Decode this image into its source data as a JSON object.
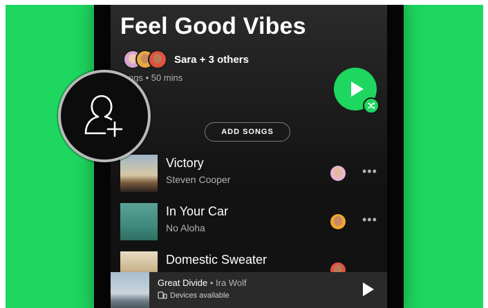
{
  "playlist": {
    "title": "Feel Good Vibes",
    "collaborators_label": "Sara + 3 others",
    "meta": "ngs • 50 mins",
    "add_songs_label": "ADD SONGS"
  },
  "tracks": [
    {
      "title": "Victory",
      "artist": "Steven Cooper"
    },
    {
      "title": "In Your Car",
      "artist": "No Aloha"
    },
    {
      "title": "Domestic Sweater",
      "artist": ""
    }
  ],
  "now_playing": {
    "title": "Great Divide",
    "separator": " • ",
    "artist": "Ira Wolf",
    "devices_label": "Devices available"
  },
  "icons": {
    "add_collaborator": "person-plus-icon",
    "play": "play-icon",
    "shuffle": "shuffle-icon",
    "more": "more-options-icon",
    "devices": "devices-icon"
  },
  "colors": {
    "background": "#1ed760",
    "accent": "#1ed760",
    "screen": "#121212",
    "text_primary": "#ffffff",
    "text_secondary": "#b3b3b3"
  }
}
